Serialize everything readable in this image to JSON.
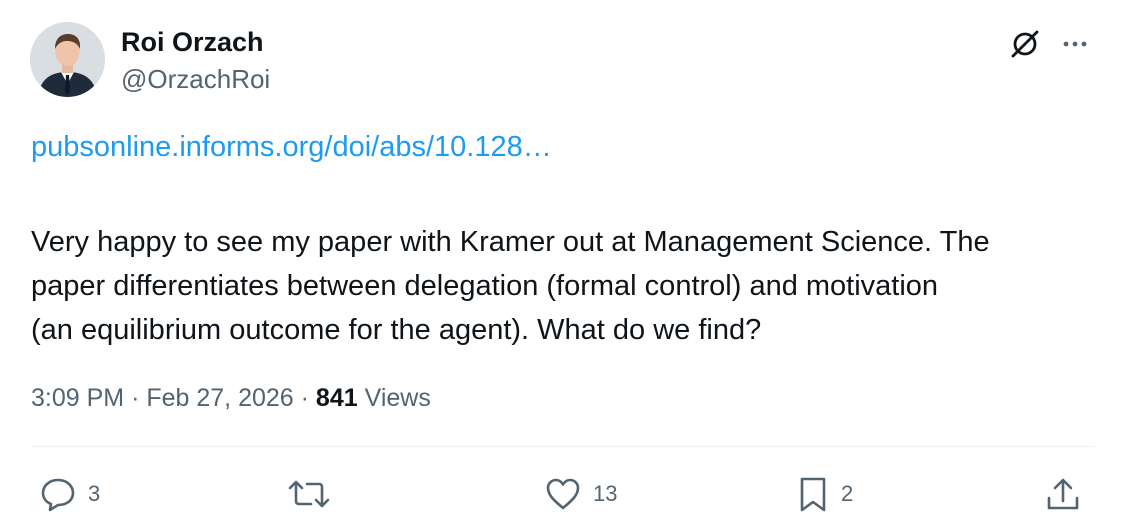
{
  "author": {
    "name": "Roi Orzach",
    "handle": "@OrzachRoi"
  },
  "header_icons": {
    "grok": "grok-icon",
    "more": "more-horizontal-icon"
  },
  "post": {
    "link_text": "pubsonline.informs.org/doi/abs/10.128…",
    "lines": [
      "Very happy to see my paper with Kramer out at Management Science. The",
      "paper differentiates between delegation (formal control) and motivation",
      "(an equilibrium outcome for the agent). What do we find?"
    ]
  },
  "meta": {
    "time": "3:09 PM",
    "separator": "·",
    "date": "Feb 27, 2026",
    "views_count": "841",
    "views_label": "Views"
  },
  "actions": {
    "reply": {
      "icon": "reply-icon",
      "count": "3"
    },
    "repost": {
      "icon": "repost-icon",
      "count": ""
    },
    "like": {
      "icon": "heart-icon",
      "count": "13"
    },
    "bookmark": {
      "icon": "bookmark-icon",
      "count": "2"
    },
    "share": {
      "icon": "share-icon",
      "count": ""
    }
  },
  "colors": {
    "link": "#1d9bf0",
    "secondary_text": "#536471",
    "primary_text": "#0f1419",
    "divider": "#eff3f4"
  }
}
